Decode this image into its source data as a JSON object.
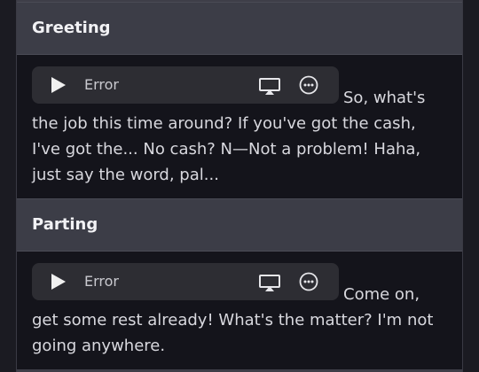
{
  "sections": [
    {
      "title": "Greeting",
      "player": {
        "status": "Error"
      },
      "text": "So, what's the job this time around? If you've got the cash, I've got the... No cash? N—Not a problem! Haha, just say the word, pal..."
    },
    {
      "title": "Parting",
      "player": {
        "status": "Error"
      },
      "text": "Come on, get some rest already! What's the matter? I'm not going anywhere."
    }
  ],
  "icons": [
    "play-icon",
    "airplay-icon",
    "more-icon"
  ]
}
